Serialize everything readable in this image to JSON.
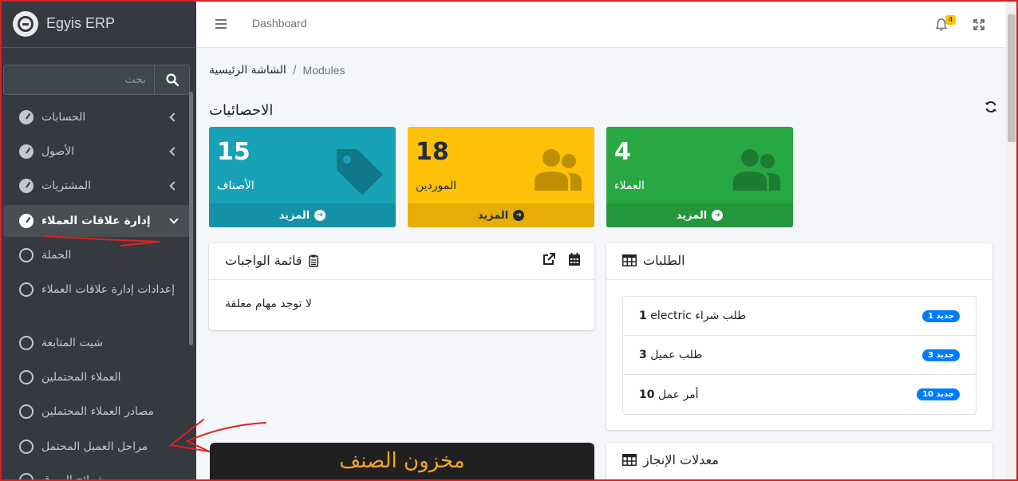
{
  "brand": {
    "title": "Egyis ERP"
  },
  "search": {
    "placeholder": "بحث"
  },
  "sidebar": {
    "items": [
      {
        "label": "الحسابات"
      },
      {
        "label": "الأصول"
      },
      {
        "label": "المشتريات"
      },
      {
        "label": "إدارة علاقات العملاء"
      }
    ],
    "sub_items": [
      {
        "label": "الحملة"
      },
      {
        "label": "إعدادات إدارة علاقات العملاء"
      },
      {
        "label": "شيت المتابعة"
      },
      {
        "label": "العملاء المحتملين"
      },
      {
        "label": "مصادر العملاء المحتملين"
      },
      {
        "label": "مراحل العميل المحتمل"
      },
      {
        "label": "شرائح السوق"
      }
    ]
  },
  "topbar": {
    "link": "Dashboard",
    "notifications_count": "4"
  },
  "breadcrumb": {
    "home": "الشاشة الرئيسية",
    "separator": "/",
    "current": "Modules"
  },
  "stats": {
    "title": "الاحصائيات",
    "boxes": [
      {
        "value": "15",
        "label": "الأصناف",
        "more": "المزيد"
      },
      {
        "value": "18",
        "label": "الموردين",
        "more": "المزيد"
      },
      {
        "value": "4",
        "label": "العملاء",
        "more": "المزيد"
      }
    ]
  },
  "tasks": {
    "title": "قائمة الواجبات",
    "empty": "لا توجد مهام معلقة"
  },
  "orders": {
    "title": "الطلبات",
    "rows": [
      {
        "text": "electric طلب شراء",
        "count": "1",
        "badge": "جديد 1"
      },
      {
        "text": "طلب عميل",
        "count": "3",
        "badge": "جديد 3"
      },
      {
        "text": "أمر عمل",
        "count": "10",
        "badge": "جديد 10"
      }
    ]
  },
  "completion": {
    "title": "معدلات الإنجاز"
  },
  "tooltip": {
    "text": "مخزون الصنف"
  },
  "colors": {
    "sidebar": "#343a40",
    "info": "#17a2b8",
    "warning": "#ffc107",
    "success": "#28a745",
    "badge": "#007bff",
    "annotation": "#e02020"
  }
}
